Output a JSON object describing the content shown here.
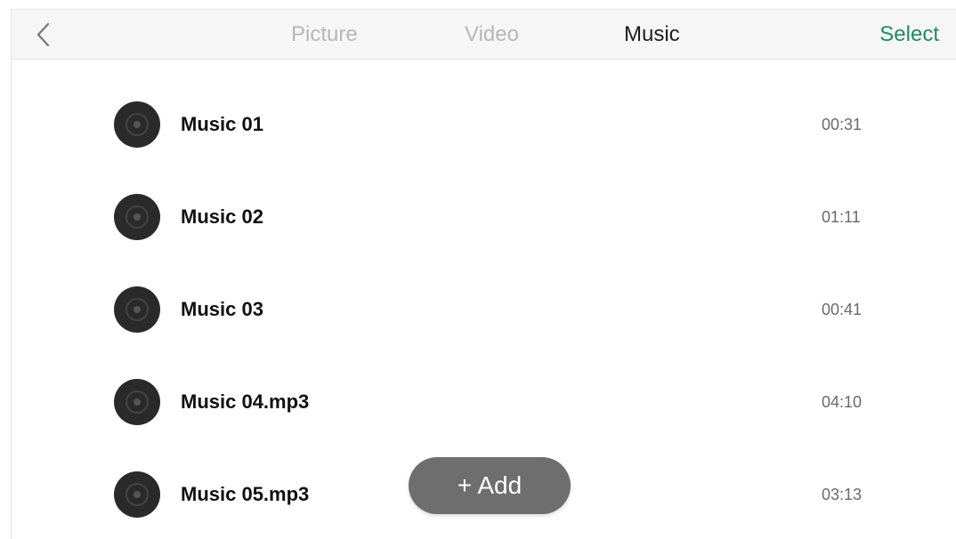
{
  "header": {
    "tabs": [
      {
        "label": "Picture",
        "active": false
      },
      {
        "label": "Video",
        "active": false
      },
      {
        "label": "Music",
        "active": true
      }
    ],
    "select_label": "Select",
    "back_icon": "chevron-left-icon"
  },
  "music_list": {
    "items": [
      {
        "name": "Music 01",
        "duration": "00:31",
        "icon": "disc-icon"
      },
      {
        "name": "Music 02",
        "duration": "01:11",
        "icon": "disc-icon"
      },
      {
        "name": "Music 03",
        "duration": "00:41",
        "icon": "disc-icon"
      },
      {
        "name": "Music 04.mp3",
        "duration": "04:10",
        "icon": "disc-icon"
      },
      {
        "name": "Music 05.mp3",
        "duration": "03:13",
        "icon": "disc-icon"
      }
    ]
  },
  "add_button": {
    "label": "+ Add"
  },
  "colors": {
    "accent": "#1f8a67",
    "active_tab": "#1e1e1e",
    "inactive_tab": "#b7b7b7",
    "add_button_bg": "#6e6e6e",
    "disc": "#2a2a2a"
  }
}
